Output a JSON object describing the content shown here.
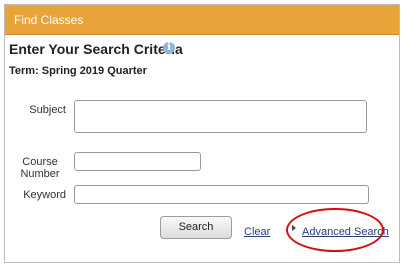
{
  "header": {
    "title": "Find Classes"
  },
  "form": {
    "heading": "Enter Your Search Criteria",
    "info_icon": "info-icon",
    "term_label": "Term:",
    "term_value": "Spring 2019 Quarter",
    "term_full": "Term: Spring 2019 Quarter",
    "subject_label": "Subject",
    "subject_value": "",
    "course_number_label_line1": "Course",
    "course_number_label_line2": "Number",
    "course_number_value": "",
    "keyword_label": "Keyword",
    "keyword_value": ""
  },
  "actions": {
    "search_label": "Search",
    "clear_label": "Clear",
    "advanced_label": "Advanced Search"
  },
  "colors": {
    "header_bg": "#e8a33a",
    "highlight_circle": "#d01010",
    "link": "#2a3f7a"
  }
}
